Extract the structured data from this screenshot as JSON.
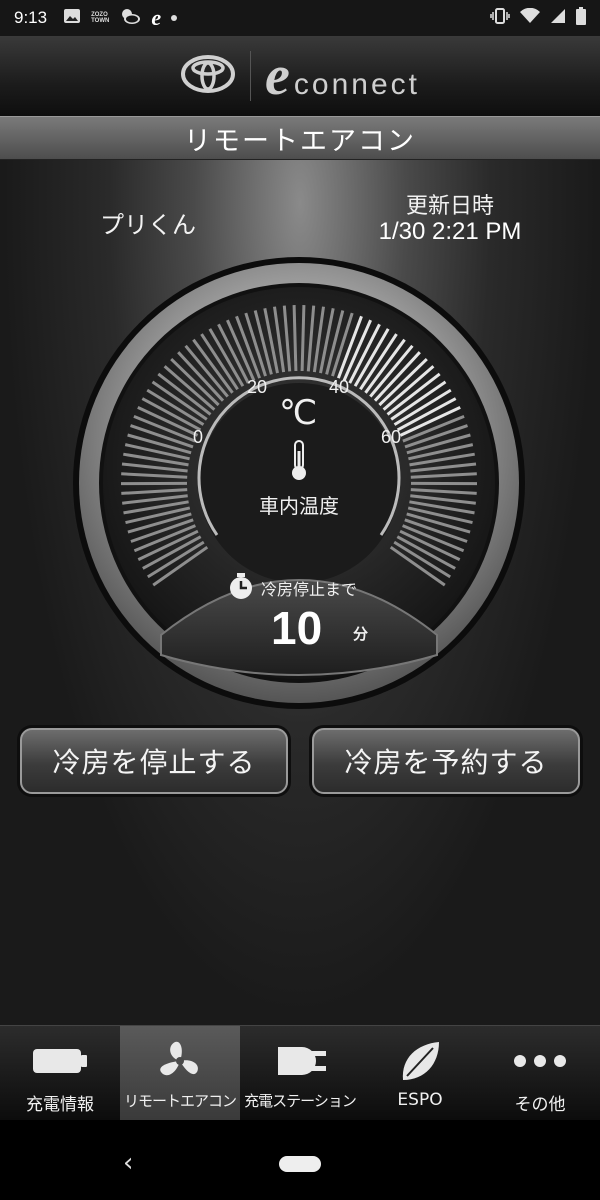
{
  "status_bar": {
    "time": "9:13",
    "zozo_line1": "ZOZO",
    "zozo_line2": "TOWN"
  },
  "header": {
    "brand_e": "e",
    "brand_connect": "connect",
    "title": "リモートエアコン"
  },
  "vehicle": {
    "name": "プリくん",
    "update_label": "更新日時",
    "update_value": "1/30 2:21 PM"
  },
  "gauge": {
    "unit": "℃",
    "label": "車内温度",
    "ticks": [
      "0",
      "20",
      "40",
      "60"
    ],
    "timer_label": "冷房停止まで",
    "timer_value": "10",
    "timer_unit": "分"
  },
  "buttons": {
    "stop": "冷房を停止する",
    "reserve": "冷房を予約する"
  },
  "nav": {
    "items": [
      {
        "label": "充電情報",
        "icon": "battery-icon"
      },
      {
        "label": "リモートエアコン",
        "icon": "fan-icon"
      },
      {
        "label": "充電ステーション",
        "icon": "plug-icon"
      },
      {
        "label": "ESPO",
        "icon": "leaf-icon"
      },
      {
        "label": "その他",
        "icon": "more-icon"
      }
    ],
    "active_index": 1
  }
}
